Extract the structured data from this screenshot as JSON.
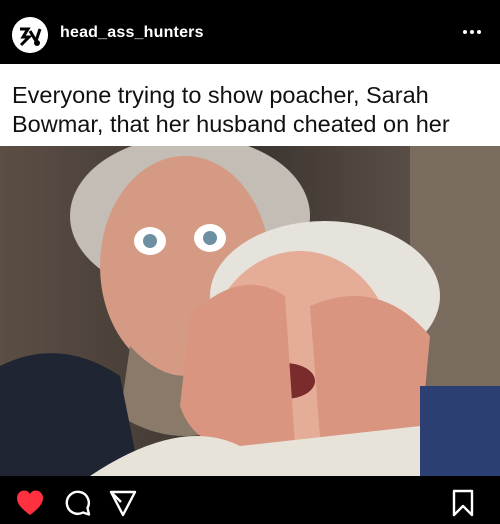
{
  "header": {
    "username": "head_ass_hunters",
    "avatar_icon": "head-ass-hunters-logo-icon",
    "more_icon": "ellipsis-icon"
  },
  "post": {
    "caption": "Everyone trying to show poacher, Sarah Bowmar, that her husband cheated on her",
    "caption_color": "#111111",
    "background": "#ffffff"
  },
  "actions": {
    "like_icon": "heart-icon",
    "like_color": "#ff3040",
    "comment_icon": "comment-icon",
    "share_icon": "share-icon",
    "save_icon": "bookmark-icon"
  }
}
